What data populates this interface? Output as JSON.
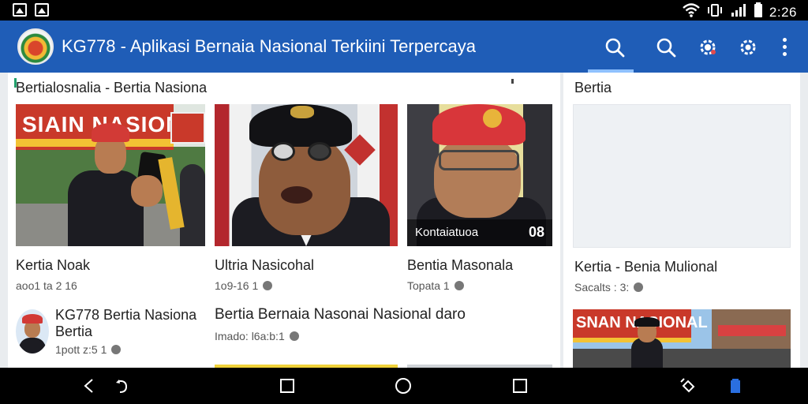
{
  "status_bar": {
    "signal": "▮▮▮",
    "battery": "▮",
    "wifi": "◉",
    "vibrate": "▯",
    "time": "2:26"
  },
  "app_bar": {
    "title": "KG778 - Aplikasi Bernaia Nasional Terkiini Terpercaya",
    "icons": [
      "search-icon",
      "search-icon",
      "settings-icon",
      "settings-icon",
      "more-vert-icon"
    ],
    "colors": {
      "primary": "#1f5db7",
      "accent": "#8fc1ff"
    }
  },
  "main": {
    "section_title": "Bertialosnalia - Bertia Nasiona",
    "cards": [
      {
        "title": "Kertia Noak",
        "meta": "aoo1 ta 2 16"
      },
      {
        "title": "Ultria Nasicohal",
        "meta": "1o9-16 1"
      },
      {
        "title": "Bentia Masonala",
        "meta": "Topata 1",
        "overlay_label": "Kontaiatuoa",
        "overlay_count": "08"
      }
    ],
    "banner_text": "SIAIN NASIONAL",
    "rows": [
      {
        "title_line1": "KG778 Bertia Nasiona",
        "title_line2": "Bertia",
        "meta": "1pott z:5 1"
      },
      {
        "title": "Bertia Bernaia Nasonai Nasional daro",
        "meta": "Imado: l6a:b:1"
      }
    ]
  },
  "side": {
    "section_title": "Bertia",
    "title": "Kertia - Benia Mulional",
    "meta": "Sacalts : 3:",
    "banner_text": "SNAN NASIONAL"
  },
  "nav_bar": {
    "icons": [
      "back-chevron-icon",
      "undo-icon",
      "square-icon",
      "home-circle-icon",
      "recents-square-icon",
      "rotate-icon",
      "notification-icon"
    ]
  }
}
